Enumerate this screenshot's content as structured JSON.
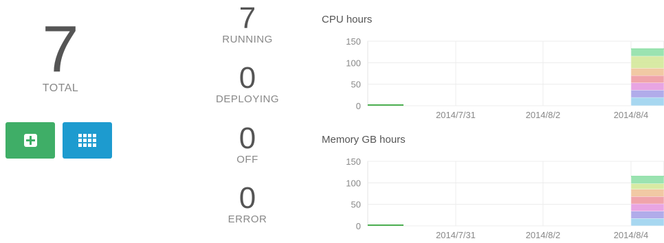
{
  "summary": {
    "total": "7",
    "total_label": "TOTAL"
  },
  "actions": {
    "add_icon": "plus-square-icon",
    "grid_icon": "grid-icon"
  },
  "stats": [
    {
      "value": "7",
      "label": "RUNNING"
    },
    {
      "value": "0",
      "label": "DEPLOYING"
    },
    {
      "value": "0",
      "label": "OFF"
    },
    {
      "value": "0",
      "label": "ERROR"
    }
  ],
  "colors": {
    "add_button": "#3fae67",
    "grid_button": "#1d9bcf"
  },
  "chart_data": [
    {
      "type": "area",
      "title": "CPU hours",
      "ylim": [
        0,
        150
      ],
      "yticks": [
        "150",
        "100",
        "50",
        "0"
      ],
      "x": [
        "2014/7/31",
        "2014/8/2",
        "2014/8/4"
      ],
      "stacked": true,
      "grid": true,
      "series": [
        {
          "values": [
            0,
            0,
            19
          ],
          "color": "#9dd3ee"
        },
        {
          "values": [
            0,
            0,
            17
          ],
          "color": "#a9a3e8"
        },
        {
          "values": [
            0,
            0,
            17
          ],
          "color": "#e69be0"
        },
        {
          "values": [
            0,
            0,
            17
          ],
          "color": "#ee9aa2"
        },
        {
          "values": [
            0,
            0,
            17
          ],
          "color": "#efc39a"
        },
        {
          "values": [
            0,
            0,
            28
          ],
          "color": "#d4e89a"
        },
        {
          "values": [
            0,
            0,
            17
          ],
          "color": "#90e0a8"
        }
      ]
    },
    {
      "type": "area",
      "title": "Memory GB hours",
      "ylim": [
        0,
        150
      ],
      "yticks": [
        "150",
        "100",
        "50",
        "0"
      ],
      "x": [
        "2014/7/31",
        "2014/8/2",
        "2014/8/4"
      ],
      "stacked": true,
      "grid": true,
      "series": [
        {
          "values": [
            0,
            0,
            17
          ],
          "color": "#9dd3ee"
        },
        {
          "values": [
            0,
            0,
            17
          ],
          "color": "#a9a3e8"
        },
        {
          "values": [
            0,
            0,
            17
          ],
          "color": "#e69be0"
        },
        {
          "values": [
            0,
            0,
            17
          ],
          "color": "#ee9aa2"
        },
        {
          "values": [
            0,
            0,
            17
          ],
          "color": "#efc39a"
        },
        {
          "values": [
            0,
            0,
            13
          ],
          "color": "#d4e89a"
        },
        {
          "values": [
            0,
            0,
            17
          ],
          "color": "#90e0a8"
        }
      ]
    }
  ]
}
